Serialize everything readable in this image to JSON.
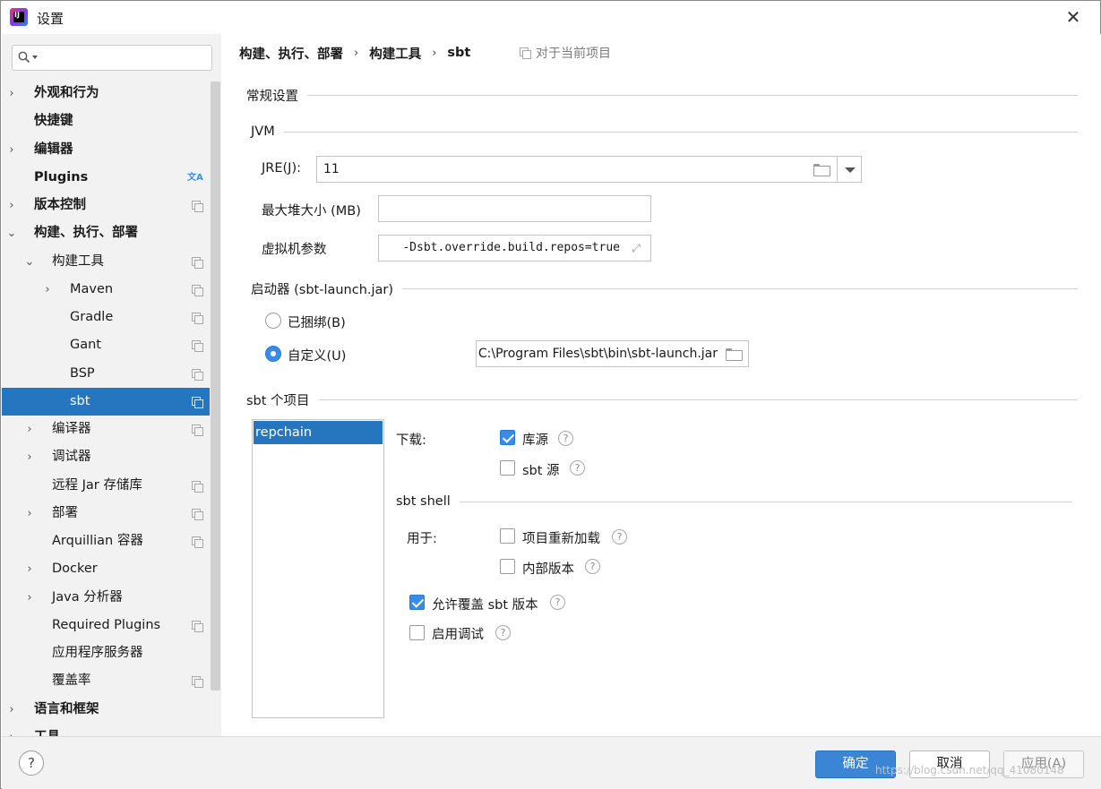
{
  "window": {
    "title": "设置",
    "app_icon_text": "IJ",
    "close_glyph": "✕"
  },
  "sidebar": {
    "search_placeholder": "",
    "items": [
      {
        "label": "外观和行为",
        "bold": true,
        "chevron": "›",
        "level": 0
      },
      {
        "label": "快捷键",
        "bold": true,
        "chevron": "",
        "level": 0
      },
      {
        "label": "编辑器",
        "bold": true,
        "chevron": "›",
        "level": 0
      },
      {
        "label": "Plugins",
        "bold": true,
        "chevron": "",
        "level": 0
      },
      {
        "label": "版本控制",
        "bold": true,
        "chevron": "›",
        "level": 0
      },
      {
        "label": "构建、执行、部署",
        "bold": true,
        "chevron": "⌄",
        "level": 0
      },
      {
        "label": "构建工具",
        "bold": false,
        "chevron": "⌄",
        "level": 1
      },
      {
        "label": "Maven",
        "bold": false,
        "chevron": "›",
        "level": 2
      },
      {
        "label": "Gradle",
        "bold": false,
        "chevron": "",
        "level": 2
      },
      {
        "label": "Gant",
        "bold": false,
        "chevron": "",
        "level": 2
      },
      {
        "label": "BSP",
        "bold": false,
        "chevron": "",
        "level": 2
      },
      {
        "label": "sbt",
        "bold": false,
        "chevron": "",
        "level": 2,
        "selected": true
      },
      {
        "label": "编译器",
        "bold": false,
        "chevron": "›",
        "level": 1
      },
      {
        "label": "调试器",
        "bold": false,
        "chevron": "›",
        "level": 1
      },
      {
        "label": "远程 Jar 存储库",
        "bold": false,
        "chevron": "",
        "level": 1
      },
      {
        "label": "部署",
        "bold": false,
        "chevron": "›",
        "level": 1
      },
      {
        "label": "Arquillian 容器",
        "bold": false,
        "chevron": "",
        "level": 1
      },
      {
        "label": "Docker",
        "bold": false,
        "chevron": "›",
        "level": 1
      },
      {
        "label": "Java 分析器",
        "bold": false,
        "chevron": "›",
        "level": 1
      },
      {
        "label": "Required Plugins",
        "bold": false,
        "chevron": "",
        "level": 1
      },
      {
        "label": "应用程序服务器",
        "bold": false,
        "chevron": "",
        "level": 1
      },
      {
        "label": "覆盖率",
        "bold": false,
        "chevron": "",
        "level": 1
      },
      {
        "label": "语言和框架",
        "bold": true,
        "chevron": "›",
        "level": 0
      },
      {
        "label": "工具",
        "bold": true,
        "chevron": "›",
        "level": 0
      }
    ]
  },
  "breadcrumb": {
    "items": [
      "构建、执行、部署",
      "构建工具",
      "sbt"
    ],
    "separator": "›",
    "note": "对于当前项目"
  },
  "general": {
    "title": "常规设置",
    "jvm": {
      "title": "JVM",
      "jre_label": "JRE(J):",
      "jre_value": "11",
      "max_heap_label": "最大堆大小 (MB)",
      "max_heap_value": "",
      "vm_params_label": "虚拟机参数",
      "vm_params_value": "-Dsbt.override.build.repos=true"
    },
    "launcher": {
      "title": "启动器 (sbt-launch.jar)",
      "bundled_label": "已捆绑(B)",
      "custom_label": "自定义(U)",
      "custom_path": "C:\\Program Files\\sbt\\bin\\sbt-launch.jar",
      "selected": "custom"
    }
  },
  "projects": {
    "title": "sbt 个项目",
    "list": [
      "repchain"
    ],
    "download_label": "下载:",
    "library_sources_label": "库源",
    "library_sources_checked": true,
    "sbt_sources_label": "sbt 源",
    "sbt_sources_checked": false,
    "shell": {
      "title": "sbt shell",
      "use_for_label": "用于:",
      "project_reload_label": "项目重新加载",
      "project_reload_checked": false,
      "builds_label": "内部版本",
      "builds_checked": false,
      "allow_override_label": "允许覆盖 sbt 版本",
      "allow_override_checked": true,
      "enable_debug_label": "启用调试",
      "enable_debug_checked": false
    }
  },
  "footer": {
    "help_glyph": "?",
    "ok_label": "确定",
    "cancel_label": "取消",
    "apply_label": "应用(A)",
    "watermark": "https://blog.csdn.net/qq_41080148"
  },
  "colors": {
    "selection": "#2675bf",
    "primary_button": "#3a85d4",
    "checkbox_on": "#3a8be6"
  }
}
